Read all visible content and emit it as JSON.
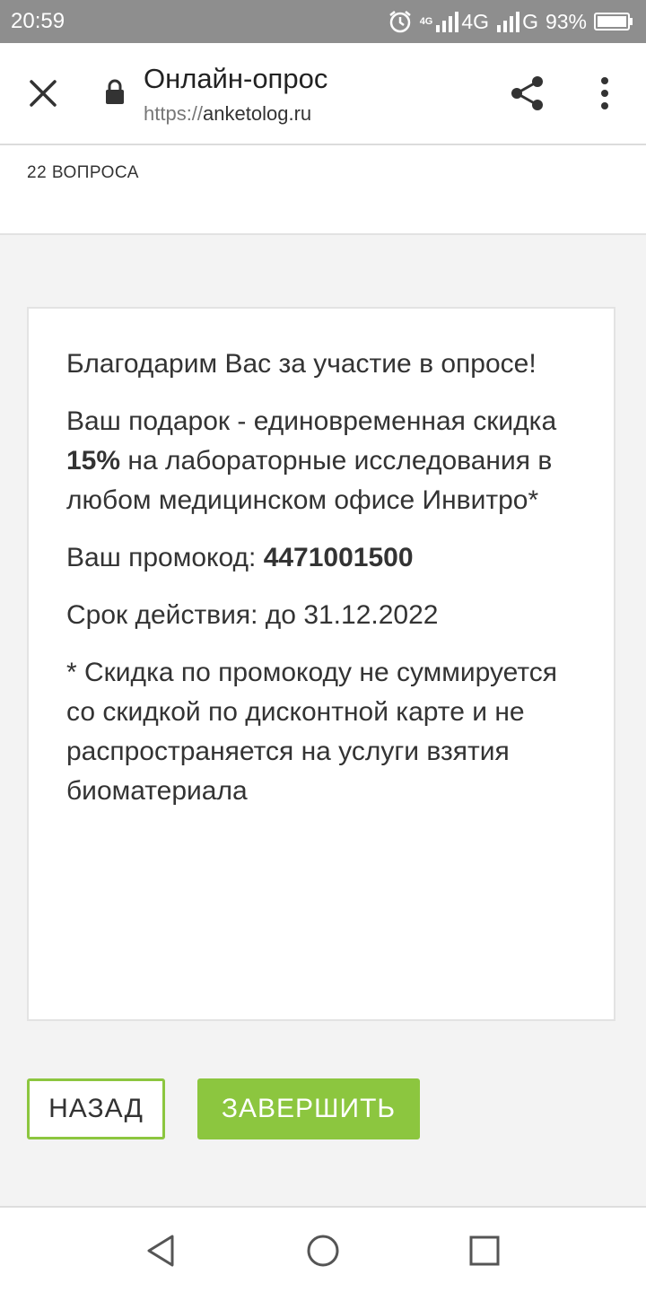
{
  "status_bar": {
    "time": "20:59",
    "network_small": "4G",
    "network1": "4G",
    "network2": "G",
    "battery": "93%"
  },
  "browser": {
    "title": "Онлайн-опрос",
    "url_scheme": "https://",
    "url_host": "anketolog.ru",
    "icons": [
      "close-icon",
      "lock-icon",
      "share-icon",
      "more-vert-icon"
    ]
  },
  "survey": {
    "question_count": "22 ВОПРОСА"
  },
  "card": {
    "thanks": "Благодарим Вас за участие в опросе!",
    "gift_before": "Ваш подарок - единовременная скидка ",
    "gift_bold": "15%",
    "gift_after": " на лабораторные исследования в любом медицинском офисе Инвитро*",
    "promo_label": "Ваш промокод: ",
    "promo_code": "4471001500",
    "validity": "Срок действия: до 31.12.2022",
    "footnote": "* Скидка по промокоду не суммируется со скидкой по дисконтной карте и не распространяется на услуги взятия биоматериала"
  },
  "buttons": {
    "back": "НАЗАД",
    "finish": "ЗАВЕРШИТЬ"
  },
  "colors": {
    "accent": "#8cc63f",
    "status_bar": "#8e8e8e",
    "background": "#f3f3f3"
  }
}
